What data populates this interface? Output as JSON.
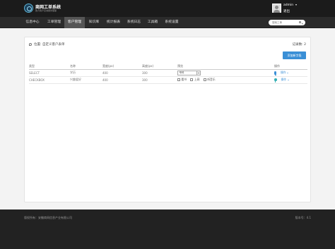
{
  "header": {
    "logo_title": "商网工单系统",
    "logo_subtitle": "致力客户至诚服务理事",
    "user_name": "admin",
    "logout_label": "退出"
  },
  "nav": {
    "items": [
      {
        "label": "信息中心"
      },
      {
        "label": "工单管理"
      },
      {
        "label": "客户管理"
      },
      {
        "label": "知识库"
      },
      {
        "label": "统计报表"
      },
      {
        "label": "系统日志"
      },
      {
        "label": "工具箱"
      },
      {
        "label": "系统设置"
      }
    ],
    "active_index": 2,
    "search_placeholder": "搜索工单"
  },
  "panel": {
    "breadcrumb": "位置: 自定义客户表单",
    "record_count": "记录数: 2",
    "add_button_label": "添加新字段",
    "table": {
      "headers": [
        "类型",
        "名称",
        "宽度(px)",
        "高度(px)",
        "预览",
        "操作"
      ],
      "rows": [
        {
          "type": "SELECT",
          "name": "学历",
          "width": "400",
          "height": "300",
          "preview_select": "专科",
          "action": "操作"
        },
        {
          "type": "CHECKBOX",
          "name": "兴趣爱好",
          "width": "400",
          "height": "300",
          "preview_options": [
            "看书",
            "上网",
            "听音乐"
          ],
          "action": "操作"
        }
      ]
    }
  },
  "footer": {
    "copyright": "版权所有：安徽商网信息产业有限公司",
    "version": "版本号：4.1"
  },
  "colors": {
    "topbar": "#1b1b1b",
    "navbar": "#2b2b2b",
    "nav_active": "#555555",
    "accent_blue": "#3a8fd6",
    "footer": "#222222"
  }
}
